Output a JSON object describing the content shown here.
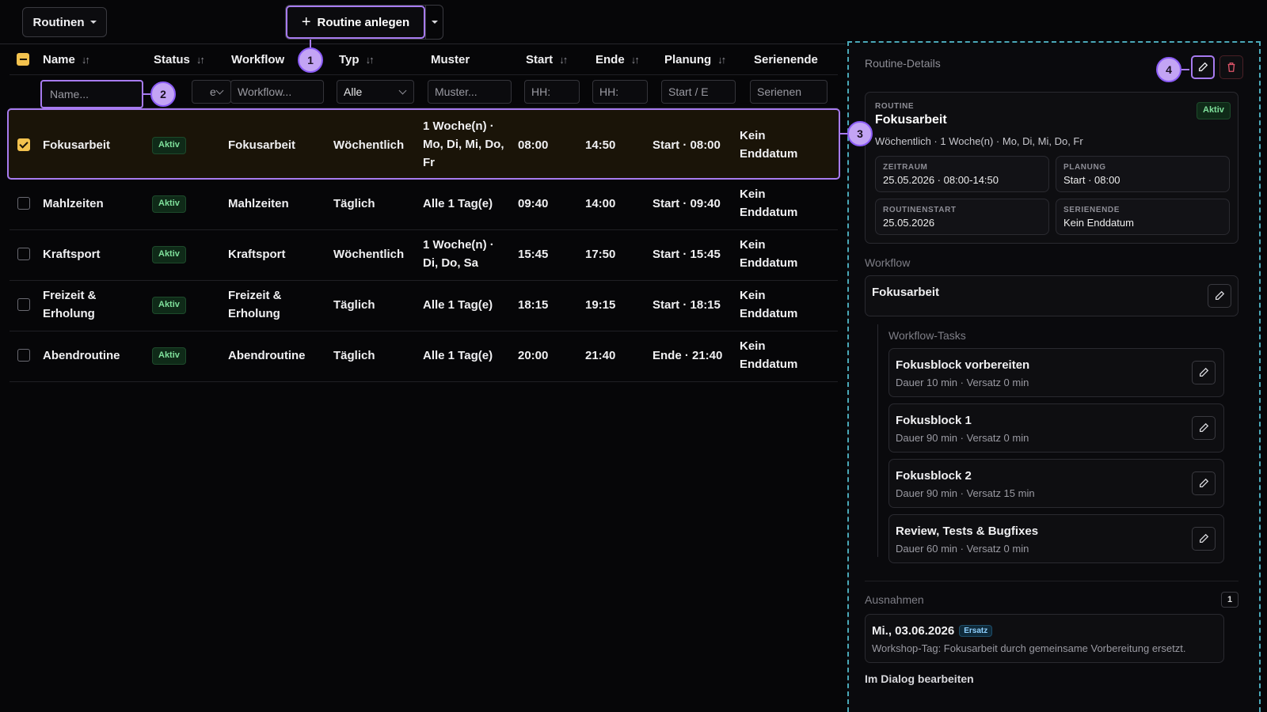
{
  "toolbar": {
    "routines_label": "Routinen",
    "create_label": "Routine anlegen"
  },
  "markers": [
    "1",
    "2",
    "3",
    "4"
  ],
  "table": {
    "columns": [
      {
        "label": "Name",
        "sortable": true
      },
      {
        "label": "Status",
        "sortable": true
      },
      {
        "label": "Workflow",
        "sortable": false
      },
      {
        "label": "Typ",
        "sortable": true
      },
      {
        "label": "Muster",
        "sortable": false
      },
      {
        "label": "Start",
        "sortable": true
      },
      {
        "label": "Ende",
        "sortable": true
      },
      {
        "label": "Planung",
        "sortable": true
      },
      {
        "label": "Serienende",
        "sortable": false
      }
    ],
    "filters": {
      "name_placeholder": "Name...",
      "status_value": "e",
      "workflow_placeholder": "Workflow...",
      "type_value": "Alle",
      "pattern_placeholder": "Muster...",
      "start_placeholder": "HH:",
      "end_placeholder": "HH:",
      "planning_placeholder": "Start / E",
      "series_placeholder": "Serienen"
    },
    "rows": [
      {
        "name": "Fokusarbeit",
        "status": "Aktiv",
        "workflow": "Fokusarbeit",
        "type": "Wöchentlich",
        "pattern_l1": "1 Woche(n) ·",
        "pattern_l2": "Mo, Di, Mi, Do,",
        "pattern_l3": "Fr",
        "start": "08:00",
        "end": "14:50",
        "planning": "Start · 08:00",
        "series_l1": "Kein",
        "series_l2": "Enddatum",
        "checked": true
      },
      {
        "name": "Mahlzeiten",
        "status": "Aktiv",
        "workflow": "Mahlzeiten",
        "type": "Täglich",
        "pattern_l1": "Alle 1 Tag(e)",
        "pattern_l2": "",
        "pattern_l3": "",
        "start": "09:40",
        "end": "14:00",
        "planning": "Start · 09:40",
        "series_l1": "Kein",
        "series_l2": "Enddatum",
        "checked": false
      },
      {
        "name": "Kraftsport",
        "status": "Aktiv",
        "workflow": "Kraftsport",
        "type": "Wöchentlich",
        "pattern_l1": "1 Woche(n) ·",
        "pattern_l2": "Di, Do, Sa",
        "pattern_l3": "",
        "start": "15:45",
        "end": "17:50",
        "planning": "Start · 15:45",
        "series_l1": "Kein",
        "series_l2": "Enddatum",
        "checked": false
      },
      {
        "name_l1": "Freizeit &",
        "name_l2": "Erholung",
        "status": "Aktiv",
        "workflow_l1": "Freizeit &",
        "workflow_l2": "Erholung",
        "type": "Täglich",
        "pattern_l1": "Alle 1 Tag(e)",
        "pattern_l2": "",
        "pattern_l3": "",
        "start": "18:15",
        "end": "19:15",
        "planning": "Start · 18:15",
        "series_l1": "Kein",
        "series_l2": "Enddatum",
        "checked": false
      },
      {
        "name": "Abendroutine",
        "status": "Aktiv",
        "workflow": "Abendroutine",
        "type": "Täglich",
        "pattern_l1": "Alle 1 Tag(e)",
        "pattern_l2": "",
        "pattern_l3": "",
        "start": "20:00",
        "end": "21:40",
        "planning": "Ende · 21:40",
        "series_l1": "Kein",
        "series_l2": "Enddatum",
        "checked": false
      }
    ]
  },
  "details": {
    "title": "Routine-Details",
    "routine_cap": "ROUTINE",
    "routine_name": "Fokusarbeit",
    "routine_status": "Aktiv",
    "routine_summary": "Wöchentlich · 1 Woche(n) · Mo, Di, Mi, Do, Fr",
    "period_cap": "ZEITRAUM",
    "period_value": "25.05.2026 · 08:00-14:50",
    "planning_cap": "PLANUNG",
    "planning_value": "Start · 08:00",
    "start_cap": "ROUTINENSTART",
    "start_value": "25.05.2026",
    "series_cap": "SERIENENDE",
    "series_value": "Kein Enddatum",
    "workflow_label": "Workflow",
    "workflow_name": "Fokusarbeit",
    "tasks_label": "Workflow-Tasks",
    "tasks": [
      {
        "title": "Fokusblock vorbereiten",
        "meta": "Dauer 10 min · Versatz 0 min"
      },
      {
        "title": "Fokusblock 1",
        "meta": "Dauer 90 min · Versatz 0 min"
      },
      {
        "title": "Fokusblock 2",
        "meta": "Dauer 90 min · Versatz 15 min"
      },
      {
        "title": "Review, Tests & Bugfixes",
        "meta": "Dauer 60 min · Versatz 0 min"
      }
    ],
    "exceptions_label": "Ausnahmen",
    "exceptions_count": "1",
    "exception_date": "Mi., 03.06.2026",
    "exception_badge": "Ersatz",
    "exception_note": "Workshop-Tag: Fokusarbeit durch gemeinsame Vorbereitung ersetzt.",
    "dialog_link": "Im Dialog bearbeiten"
  },
  "colors": {
    "accent": "#a77bf0",
    "checkbox": "#f3c24e",
    "active_badge": "#7fe09b",
    "panel_border": "#4aa8b8",
    "delete": "#e0556a"
  },
  "icons": [
    "caret-down-icon",
    "plus-icon",
    "sort-icon",
    "chevron-down-icon",
    "pencil-icon",
    "trash-icon",
    "check-icon"
  ]
}
